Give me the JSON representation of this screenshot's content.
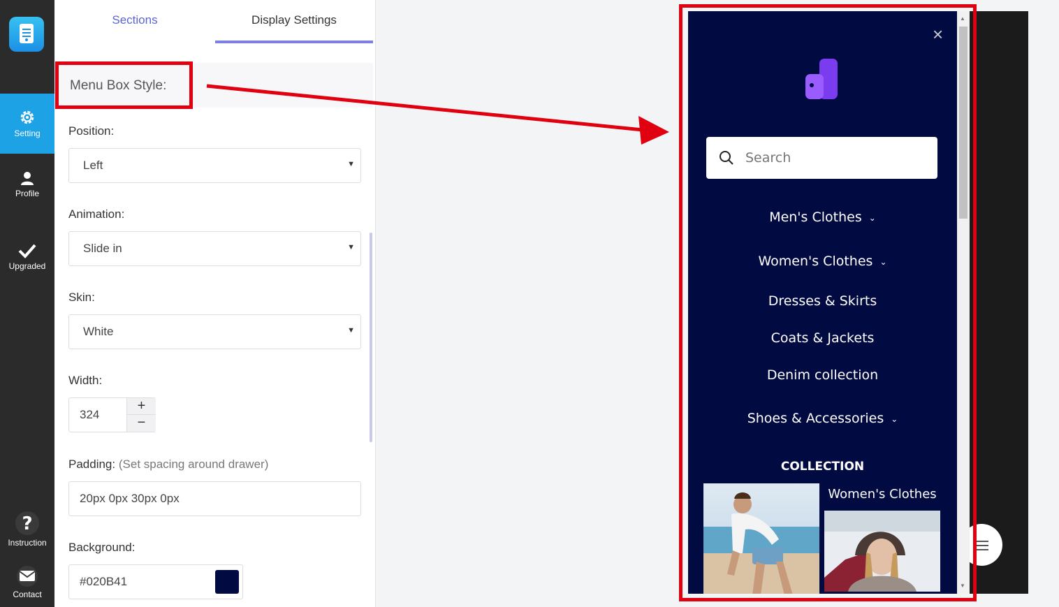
{
  "rail": {
    "items": [
      {
        "label": "Setting",
        "icon": "gear-icon",
        "active": true
      },
      {
        "label": "Profile",
        "icon": "user-icon"
      },
      {
        "label": "Upgraded",
        "icon": "check-icon"
      },
      {
        "label": "Instruction",
        "icon": "question-icon"
      },
      {
        "label": "Contact",
        "icon": "mail-icon"
      }
    ]
  },
  "tabs": {
    "sections": "Sections",
    "display": "Display Settings"
  },
  "settings": {
    "section_title": "Menu Box Style:",
    "position": {
      "label": "Position:",
      "value": "Left"
    },
    "animation": {
      "label": "Animation:",
      "value": "Slide in"
    },
    "skin": {
      "label": "Skin:",
      "value": "White"
    },
    "width": {
      "label": "Width:",
      "value": "324",
      "plus": "+",
      "minus": "−"
    },
    "padding": {
      "label": "Padding:",
      "note": "(Set spacing around drawer)",
      "value": "20px 0px 30px 0px"
    },
    "background": {
      "label": "Background:",
      "value": "#020B41",
      "swatch": "#020B41"
    }
  },
  "colors": {
    "accent": "#5d63d6",
    "highlight": "#e0000f",
    "rail_active": "#1ea2e6",
    "drawer_bg": "#020b41"
  },
  "preview": {
    "close": "×",
    "search_placeholder": "Search",
    "menu": [
      {
        "label": "Men's Clothes",
        "has_children": true
      },
      {
        "label": "Women's Clothes",
        "has_children": true
      },
      {
        "label": "Dresses & Skirts",
        "has_children": false
      },
      {
        "label": "Coats & Jackets",
        "has_children": false
      },
      {
        "label": "Denim collection",
        "has_children": false
      },
      {
        "label": "Shoes & Accessories",
        "has_children": true
      }
    ],
    "collection_title": "COLLECTION",
    "collection_label": "Women's Clothes"
  }
}
